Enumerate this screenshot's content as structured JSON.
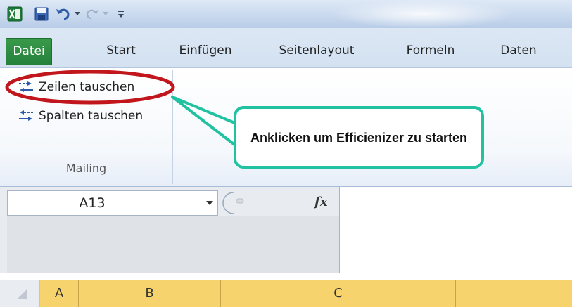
{
  "quick_access": {
    "icons": [
      "excel-logo-icon",
      "save-icon",
      "undo-icon",
      "undo-dropdown-icon",
      "redo-icon",
      "redo-dropdown-icon",
      "customize-toolbar-icon"
    ]
  },
  "tabs": [
    {
      "label": "Datei",
      "active": true
    },
    {
      "label": "Start"
    },
    {
      "label": "Einfügen"
    },
    {
      "label": "Seitenlayout"
    },
    {
      "label": "Formeln"
    },
    {
      "label": "Daten"
    }
  ],
  "ribbon": {
    "buttons": [
      {
        "label": "Zeilen tauschen",
        "icon": "swap-rows-icon"
      },
      {
        "label": "Spalten tauschen",
        "icon": "swap-columns-icon"
      }
    ],
    "group_label": "Mailing"
  },
  "formula_bar": {
    "name_box": "A13",
    "fx_label": "fx",
    "formula": ""
  },
  "columns": [
    "A",
    "B",
    "C"
  ],
  "callout": {
    "text": "Anklicken um Efficienizer zu starten"
  },
  "colors": {
    "file_tab": "#2a8a3e",
    "callout_border": "#21c2a2",
    "highlight_ellipse": "#c0161c",
    "selected_column_header": "#f7d36d"
  }
}
